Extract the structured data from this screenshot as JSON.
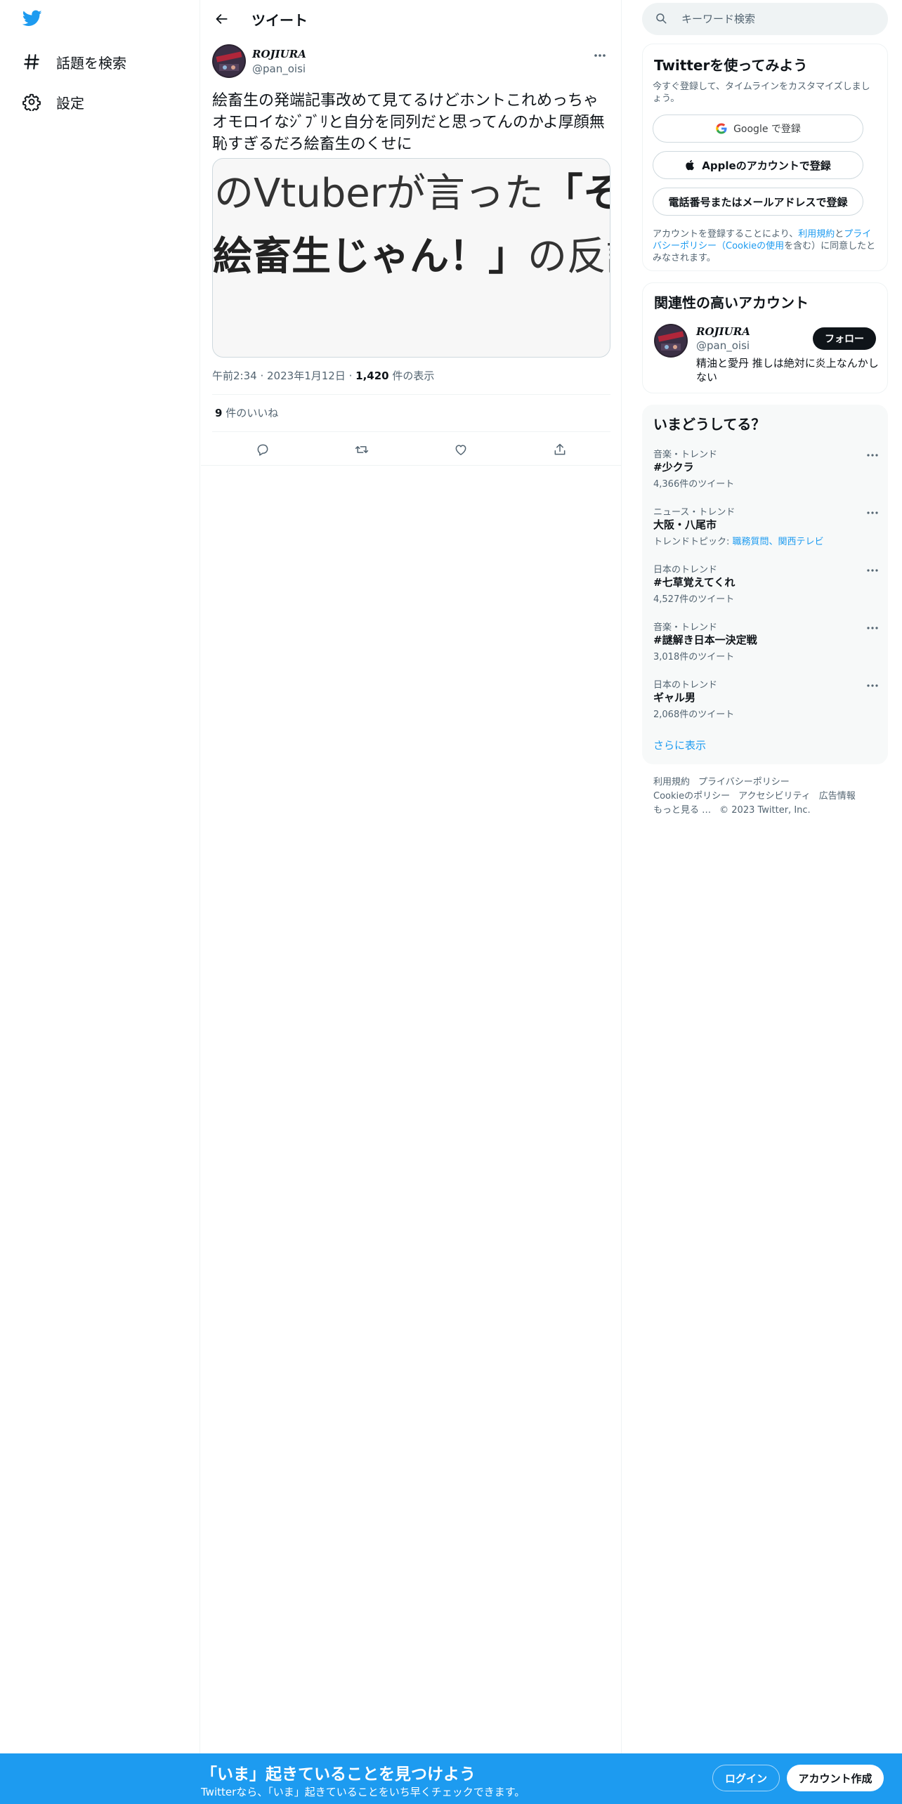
{
  "colors": {
    "accent": "#1d9bf0",
    "text": "#0f1419",
    "muted": "#536471",
    "border": "#eff3f4"
  },
  "left_nav": {
    "logo": "twitter-bird-icon",
    "items": [
      {
        "label": "話題を検索",
        "icon": "hashtag-icon"
      },
      {
        "label": "設定",
        "icon": "gear-icon"
      }
    ]
  },
  "header": {
    "title": "ツイート"
  },
  "tweet": {
    "author_name": "ROJIURA",
    "author_handle": "@pan_oisi",
    "text": "絵畜生の発端記事改めて見てるけどホントこれめっちゃオモロイなｼﾞﾌﾞﾘと自分を同列だと思ってんのかよ厚顔無恥すぎるだろ絵畜生のくせに",
    "media": {
      "line1_regular": "のVtuberが言った",
      "line1_bold": "「そん",
      "line2_bold": "絵畜生じゃん！」",
      "line2_regular": "の反誤"
    },
    "time": "午前2:34",
    "date": "2023年1月12日",
    "views_count": "1,420",
    "views_label": " 件の表示",
    "likes_count": "9",
    "likes_label": " 件のいいね",
    "actions": [
      "reply-icon",
      "retweet-icon",
      "like-icon",
      "share-icon"
    ]
  },
  "search": {
    "placeholder": "キーワード検索"
  },
  "signup_card": {
    "title": "Twitterを使ってみよう",
    "subtitle": "今すぐ登録して、タイムラインをカスタマイズしましょう。",
    "google_button": "Google で登録",
    "apple_button": "Appleのアカウントで登録",
    "phone_button": "電話番号またはメールアドレスで登録",
    "terms_prefix": "アカウントを登録することにより、",
    "terms_link1": "利用規約",
    "terms_and": "と",
    "terms_link2": "プライバシーポリシー（Cookieの使用",
    "terms_suffix": "を含む）に同意したとみなされます。"
  },
  "related_card": {
    "title": "関連性の高いアカウント",
    "name": "ROJIURA",
    "handle": "@pan_oisi",
    "bio": "精油と愛丹 推しは絶対に炎上なんかしない",
    "follow_button": "フォロー"
  },
  "trends_card": {
    "title": "いまどうしてる？",
    "items": [
      {
        "meta": "音楽・トレンド",
        "name": "#少クラ",
        "count": "4,366件のツイート"
      },
      {
        "meta": "ニュース・トレンド",
        "name": "大阪・八尾市",
        "count_prefix": "トレンドトピック: ",
        "count_link1": "職務質問",
        "count_sep": "、",
        "count_link2": "関西テレビ"
      },
      {
        "meta": "日本のトレンド",
        "name": "#七草覚えてくれ",
        "count": "4,527件のツイート"
      },
      {
        "meta": "音楽・トレンド",
        "name": "#謎解き日本一決定戦",
        "count": "3,018件のツイート"
      },
      {
        "meta": "日本のトレンド",
        "name": "ギャル男",
        "count": "2,068件のツイート"
      }
    ],
    "show_more": "さらに表示"
  },
  "footer": {
    "links": [
      "利用規約",
      "プライバシーポリシー",
      "Cookieのポリシー",
      "アクセシビリティ",
      "広告情報",
      "もっと見る …",
      "© 2023 Twitter, Inc."
    ]
  },
  "bottom_bar": {
    "title": "「いま」起きていることを見つけよう",
    "subtitle": "Twitterなら、「いま」起きていることをいち早くチェックできます。",
    "login": "ログイン",
    "signup": "アカウント作成"
  }
}
